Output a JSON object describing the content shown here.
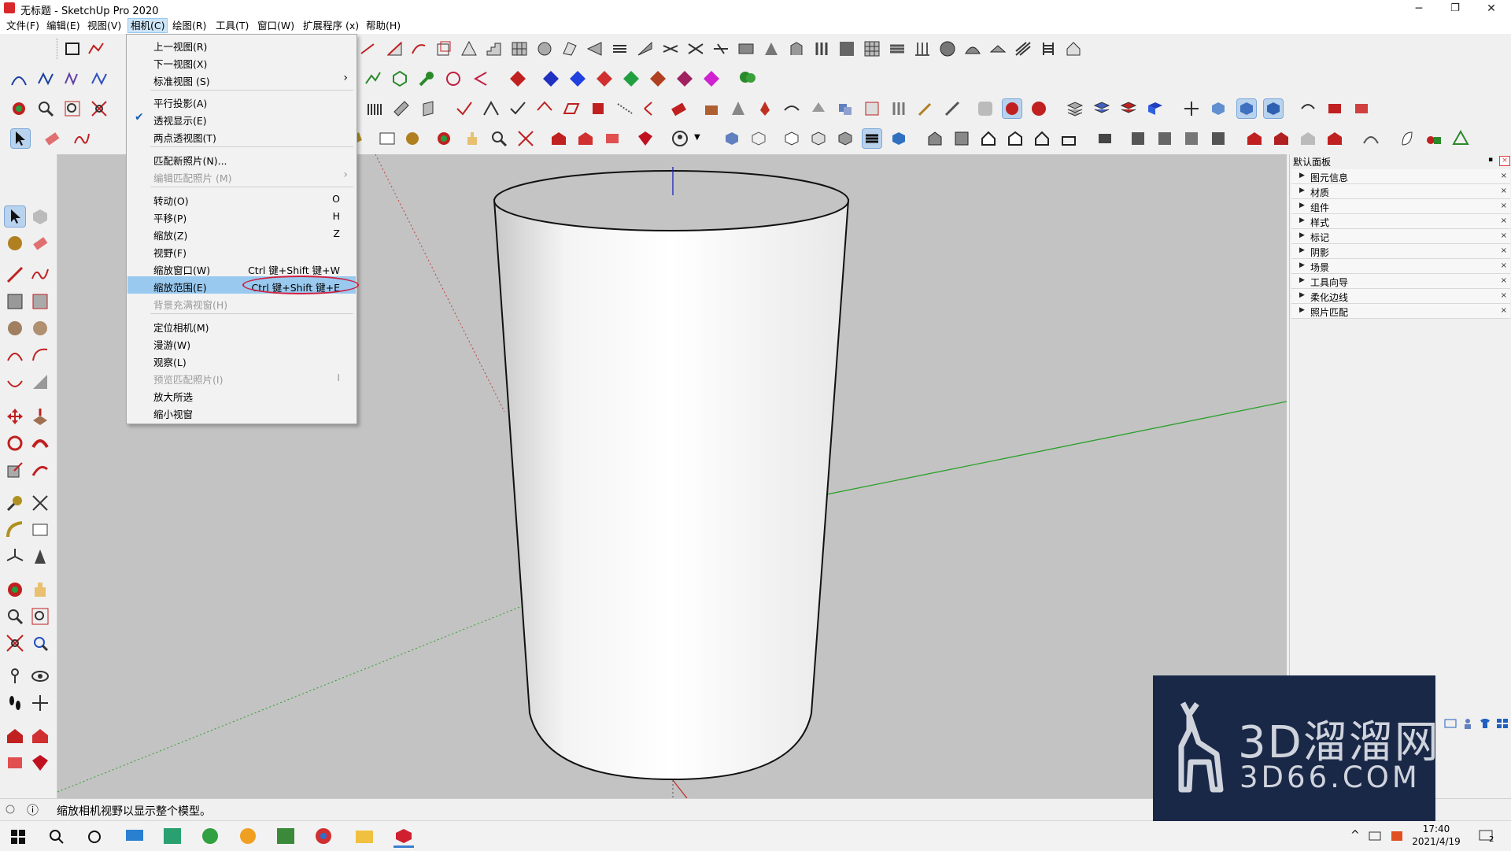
{
  "window": {
    "title": "无标题 - SketchUp Pro 2020",
    "minimize": "─",
    "restore": "❐",
    "close": "✕"
  },
  "menubar": {
    "items": [
      {
        "label": "文件(F)"
      },
      {
        "label": "编辑(E)"
      },
      {
        "label": "视图(V)"
      },
      {
        "label": "相机(C)"
      },
      {
        "label": "绘图(R)"
      },
      {
        "label": "工具(T)"
      },
      {
        "label": "窗口(W)"
      },
      {
        "label": "扩展程序 (x)"
      },
      {
        "label": "帮助(H)"
      }
    ]
  },
  "camera_menu": {
    "items": [
      {
        "label": "上一视图(R)"
      },
      {
        "label": "下一视图(X)"
      },
      {
        "label": "标准视图 (S)",
        "submenu": "›"
      },
      {
        "label": "平行投影(A)"
      },
      {
        "label": "透视显示(E)",
        "check": "✔"
      },
      {
        "label": "两点透视图(T)"
      },
      {
        "label": "匹配新照片(N)..."
      },
      {
        "label": "编辑匹配照片 (M)",
        "submenu": "›"
      },
      {
        "label": "转动(O)",
        "shortcut": "O"
      },
      {
        "label": "平移(P)",
        "shortcut": "H"
      },
      {
        "label": "缩放(Z)",
        "shortcut": "Z"
      },
      {
        "label": "视野(F)"
      },
      {
        "label": "缩放窗口(W)",
        "shortcut": "Ctrl 键+Shift 键+W"
      },
      {
        "label": "缩放范围(E)",
        "shortcut": "Ctrl 键+Shift 键+E"
      },
      {
        "label": "背景充满视窗(H)"
      },
      {
        "label": "定位相机(M)"
      },
      {
        "label": "漫游(W)"
      },
      {
        "label": "观察(L)"
      },
      {
        "label": "预览匹配照片(I)",
        "shortcut": "I"
      },
      {
        "label": "放大所选"
      },
      {
        "label": "缩小视窗"
      }
    ]
  },
  "right_panel": {
    "title": "默认面板",
    "close": "×",
    "trays": [
      {
        "label": "图元信息",
        "arrow": "▶",
        "close": "×"
      },
      {
        "label": "材质",
        "arrow": "▶",
        "close": "×"
      },
      {
        "label": "组件",
        "arrow": "▶",
        "close": "×"
      },
      {
        "label": "样式",
        "arrow": "▶",
        "close": "×"
      },
      {
        "label": "标记",
        "arrow": "▶",
        "close": "×"
      },
      {
        "label": "阴影",
        "arrow": "▶",
        "close": "×"
      },
      {
        "label": "场景",
        "arrow": "▶",
        "close": "×"
      },
      {
        "label": "工具向导",
        "arrow": "▶",
        "close": "×"
      },
      {
        "label": "柔化边线",
        "arrow": "▶",
        "close": "×"
      },
      {
        "label": "照片匹配",
        "arrow": "▶",
        "close": "×"
      }
    ]
  },
  "status": {
    "message": "缩放相机视野以显示整个模型。",
    "info_icon": "ⓘ"
  },
  "taskbar": {
    "time": "17:40",
    "date": "2021/4/19",
    "notifications": "2"
  },
  "watermark": {
    "brand": "3D溜溜网",
    "domain": "3D66.COM"
  },
  "colors": {
    "menu_highlight": "#99c9ef",
    "annotation_ring": "#d02040",
    "viewport_bg": "#c3c3c3",
    "axis_red": "#c03030",
    "axis_green": "#2aa02a",
    "axis_blue": "#2020c0"
  }
}
